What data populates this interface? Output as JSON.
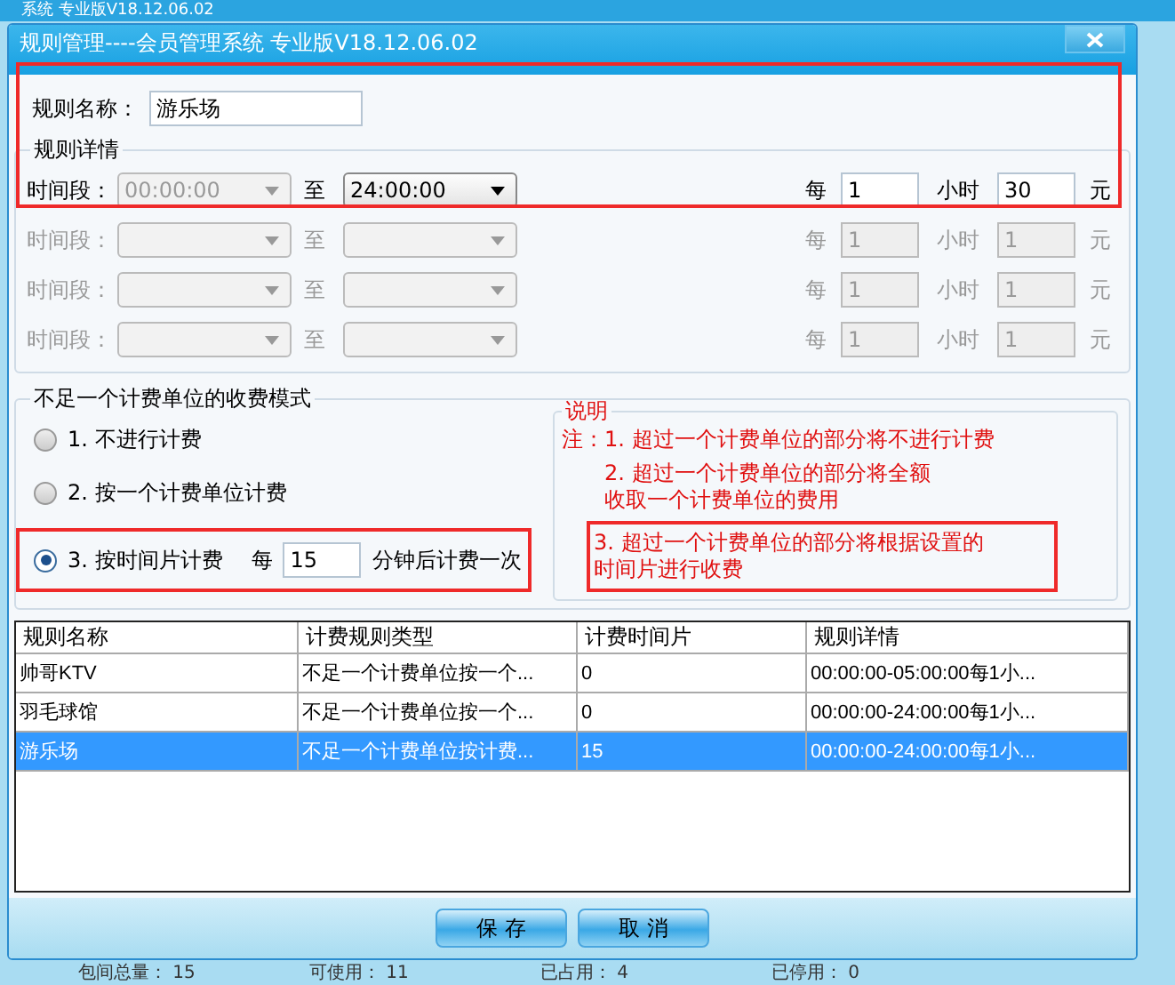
{
  "background_app": {
    "title": "系统 专业版V18.12.06.02",
    "status_bar": [
      {
        "label": "包间总量：",
        "value": "15"
      },
      {
        "label": "可使用：",
        "value": "11"
      },
      {
        "label": "已占用：",
        "value": "4"
      },
      {
        "label": "已停用：",
        "value": "0"
      }
    ]
  },
  "dialog": {
    "title": "规则管理----会员管理系统 专业版V18.12.06.02",
    "rule_name": {
      "label": "规则名称：",
      "value": "游乐场"
    },
    "details": {
      "title": "规则详情",
      "rows": [
        {
          "label": "时间段：",
          "disabled": false,
          "from": {
            "value": "00:00:00",
            "disabled": true
          },
          "to_label": "至",
          "to": {
            "value": "24:00:00",
            "disabled": false
          },
          "per_label": "每",
          "hours": {
            "value": "1",
            "disabled": false
          },
          "unit": "小时",
          "price": {
            "value": "30",
            "disabled": false
          },
          "currency": "元"
        },
        {
          "label": "时间段：",
          "disabled": true,
          "from": {
            "disabled": true
          },
          "to_label": "至",
          "to": {
            "disabled": true
          },
          "per_label": "每",
          "hours": {
            "value": "1",
            "disabled": true
          },
          "unit": "小时",
          "price": {
            "value": "1",
            "disabled": true
          },
          "currency": "元"
        },
        {
          "label": "时间段：",
          "disabled": true,
          "from": {
            "disabled": true
          },
          "to_label": "至",
          "to": {
            "disabled": true
          },
          "per_label": "每",
          "hours": {
            "value": "1",
            "disabled": true
          },
          "unit": "小时",
          "price": {
            "value": "1",
            "disabled": true
          },
          "currency": "元"
        },
        {
          "label": "时间段：",
          "disabled": true,
          "from": {
            "disabled": true
          },
          "to_label": "至",
          "to": {
            "disabled": true
          },
          "per_label": "每",
          "hours": {
            "value": "1",
            "disabled": true
          },
          "unit": "小时",
          "price": {
            "value": "1",
            "disabled": true
          },
          "currency": "元"
        }
      ]
    },
    "mode": {
      "title": "不足一个计费单位的收费模式",
      "options": [
        {
          "label": "1. 不进行计费",
          "selected": false
        },
        {
          "label": "2. 按一个计费单位计费",
          "selected": false
        },
        {
          "label": "3. 按时间片计费",
          "selected": true,
          "interval": {
            "prefix": "每",
            "value": "15",
            "suffix": "分钟后计费一次"
          }
        }
      ]
    },
    "notes": {
      "title": "说明",
      "prefix": "注：",
      "items": [
        {
          "lines": [
            "1. 超过一个计费单位的部分将不进行计费"
          ]
        },
        {
          "lines": [
            "2. 超过一个计费单位的部分将全额",
            "收取一个计费单位的费用"
          ]
        },
        {
          "lines": [
            "3. 超过一个计费单位的部分将根据设置的",
            "时间片进行收费"
          ]
        }
      ]
    },
    "table": {
      "columns": [
        "规则名称",
        "计费规则类型",
        "计费时间片",
        "规则详情"
      ],
      "rows": [
        {
          "cells": [
            "帅哥KTV",
            "不足一个计费单位按一个...",
            "0",
            "00:00:00-05:00:00每1小..."
          ],
          "selected": false
        },
        {
          "cells": [
            "羽毛球馆",
            "不足一个计费单位按一个...",
            "0",
            "00:00:00-24:00:00每1小..."
          ],
          "selected": false
        },
        {
          "cells": [
            "游乐场",
            "不足一个计费单位按计费...",
            "15",
            "00:00:00-24:00:00每1小..."
          ],
          "selected": true
        }
      ]
    },
    "buttons": [
      "保 存",
      "取 消"
    ]
  }
}
